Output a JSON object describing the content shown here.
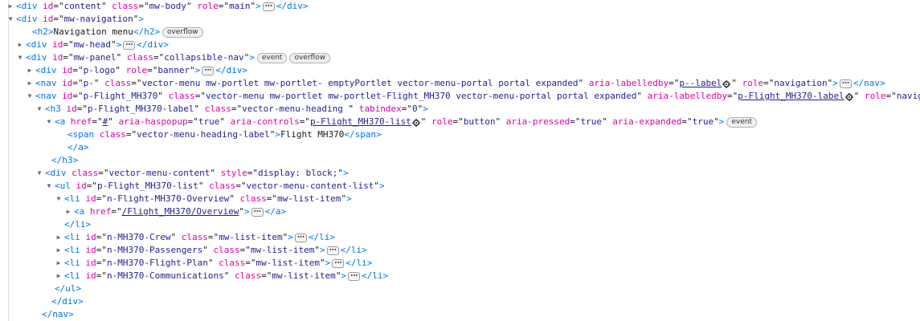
{
  "lines": [
    {
      "parts": [
        [
          "tag",
          "<"
        ],
        [
          "tname",
          "div"
        ],
        [
          "sp",
          " "
        ],
        [
          "attr",
          "id"
        ],
        [
          "eq",
          "=\""
        ],
        [
          "val",
          "content"
        ],
        [
          "eq",
          "\" "
        ],
        [
          "attr",
          "class"
        ],
        [
          "eq",
          "=\""
        ],
        [
          "val",
          "mw-body"
        ],
        [
          "eq",
          "\" "
        ],
        [
          "attr",
          "role"
        ],
        [
          "eq",
          "=\""
        ],
        [
          "val",
          "main"
        ],
        [
          "eq",
          "\""
        ],
        [
          "tag",
          ">"
        ],
        [
          "ell",
          ""
        ],
        [
          "tag",
          "</"
        ],
        [
          "tname",
          "div"
        ],
        [
          "tag",
          ">"
        ]
      ]
    },
    {
      "parts": [
        [
          "tag",
          "<"
        ],
        [
          "tname",
          "div"
        ],
        [
          "sp",
          " "
        ],
        [
          "attr",
          "id"
        ],
        [
          "eq",
          "=\""
        ],
        [
          "val",
          "mw-navigation"
        ],
        [
          "eq",
          "\""
        ],
        [
          "tag",
          ">"
        ]
      ]
    },
    {
      "parts": [
        [
          "tag",
          "<"
        ],
        [
          "tname",
          "h2"
        ],
        [
          "tag",
          ">"
        ],
        [
          "text",
          "Navigation menu"
        ],
        [
          "tag",
          "</"
        ],
        [
          "tname",
          "h2"
        ],
        [
          "tag",
          ">"
        ],
        [
          "badge",
          "overflow"
        ]
      ]
    },
    {
      "parts": [
        [
          "tag",
          "<"
        ],
        [
          "tname",
          "div"
        ],
        [
          "sp",
          " "
        ],
        [
          "attr",
          "id"
        ],
        [
          "eq",
          "=\""
        ],
        [
          "val",
          "mw-head"
        ],
        [
          "eq",
          "\""
        ],
        [
          "tag",
          ">"
        ],
        [
          "ell",
          ""
        ],
        [
          "tag",
          "</"
        ],
        [
          "tname",
          "div"
        ],
        [
          "tag",
          ">"
        ]
      ]
    },
    {
      "parts": [
        [
          "tag",
          "<"
        ],
        [
          "tname",
          "div"
        ],
        [
          "sp",
          " "
        ],
        [
          "attr",
          "id"
        ],
        [
          "eq",
          "=\""
        ],
        [
          "val",
          "mw-panel"
        ],
        [
          "eq",
          "\" "
        ],
        [
          "attr",
          "class"
        ],
        [
          "eq",
          "=\""
        ],
        [
          "val",
          "collapsible-nav"
        ],
        [
          "eq",
          "\""
        ],
        [
          "tag",
          ">"
        ],
        [
          "badge",
          "event"
        ],
        [
          "badge",
          "overflow"
        ]
      ]
    },
    {
      "parts": [
        [
          "tag",
          "<"
        ],
        [
          "tname",
          "div"
        ],
        [
          "sp",
          " "
        ],
        [
          "attr",
          "id"
        ],
        [
          "eq",
          "=\""
        ],
        [
          "val",
          "p-logo"
        ],
        [
          "eq",
          "\" "
        ],
        [
          "attr",
          "role"
        ],
        [
          "eq",
          "=\""
        ],
        [
          "val",
          "banner"
        ],
        [
          "eq",
          "\""
        ],
        [
          "tag",
          ">"
        ],
        [
          "ell",
          ""
        ],
        [
          "tag",
          "</"
        ],
        [
          "tname",
          "div"
        ],
        [
          "tag",
          ">"
        ]
      ]
    },
    {
      "parts": [
        [
          "tag",
          "<"
        ],
        [
          "tname",
          "nav"
        ],
        [
          "sp",
          " "
        ],
        [
          "attr",
          "id"
        ],
        [
          "eq",
          "=\""
        ],
        [
          "val",
          "p-"
        ],
        [
          "eq",
          "\" "
        ],
        [
          "attr",
          "class"
        ],
        [
          "eq",
          "=\""
        ],
        [
          "val",
          "vector-menu mw-portlet mw-portlet- emptyPortlet vector-menu-portal portal expanded"
        ],
        [
          "eq",
          "\" "
        ],
        [
          "attr",
          "aria-labelledby"
        ],
        [
          "eq",
          "=\""
        ],
        [
          "link",
          "p--label"
        ],
        [
          "gear",
          ""
        ],
        [
          "eq",
          "\" "
        ],
        [
          "attr",
          "role"
        ],
        [
          "eq",
          "=\""
        ],
        [
          "val",
          "navigation"
        ],
        [
          "eq",
          "\""
        ],
        [
          "tag",
          ">"
        ],
        [
          "ell",
          ""
        ],
        [
          "tag",
          "</"
        ],
        [
          "tname",
          "nav"
        ],
        [
          "tag",
          ">"
        ]
      ]
    },
    {
      "parts": [
        [
          "tag",
          "<"
        ],
        [
          "tname",
          "nav"
        ],
        [
          "sp",
          " "
        ],
        [
          "attr",
          "id"
        ],
        [
          "eq",
          "=\""
        ],
        [
          "val",
          "p-Flight_MH370"
        ],
        [
          "eq",
          "\" "
        ],
        [
          "attr",
          "class"
        ],
        [
          "eq",
          "=\""
        ],
        [
          "val",
          "vector-menu mw-portlet mw-portlet-Flight_MH370 vector-menu-portal portal expanded"
        ],
        [
          "eq",
          "\" "
        ],
        [
          "attr",
          "aria-labelledby"
        ],
        [
          "eq",
          "=\""
        ],
        [
          "link",
          "p-Flight_MH370-label"
        ],
        [
          "gear",
          ""
        ],
        [
          "eq",
          "\" "
        ],
        [
          "attr",
          "role"
        ],
        [
          "eq",
          "=\""
        ],
        [
          "val",
          "navigation"
        ],
        [
          "eq",
          "\""
        ],
        [
          "tag",
          ">"
        ]
      ]
    },
    {
      "parts": [
        [
          "tag",
          "<"
        ],
        [
          "tname",
          "h3"
        ],
        [
          "sp",
          " "
        ],
        [
          "attr",
          "id"
        ],
        [
          "eq",
          "=\""
        ],
        [
          "val",
          "p-Flight_MH370-label"
        ],
        [
          "eq",
          "\" "
        ],
        [
          "attr",
          "class"
        ],
        [
          "eq",
          "=\""
        ],
        [
          "val",
          "vector-menu-heading "
        ],
        [
          "eq",
          "\" "
        ],
        [
          "attr",
          "tabindex"
        ],
        [
          "eq",
          "=\""
        ],
        [
          "val",
          "0"
        ],
        [
          "eq",
          "\""
        ],
        [
          "tag",
          ">"
        ]
      ]
    },
    {
      "parts": [
        [
          "tag",
          "<"
        ],
        [
          "tname",
          "a"
        ],
        [
          "sp",
          " "
        ],
        [
          "attr",
          "href"
        ],
        [
          "eq",
          "=\""
        ],
        [
          "link",
          "#"
        ],
        [
          "eq",
          "\" "
        ],
        [
          "attr",
          "aria-haspopup"
        ],
        [
          "eq",
          "=\""
        ],
        [
          "val",
          "true"
        ],
        [
          "eq",
          "\" "
        ],
        [
          "attr",
          "aria-controls"
        ],
        [
          "eq",
          "=\""
        ],
        [
          "link",
          "p-Flight_MH370-list"
        ],
        [
          "gear",
          ""
        ],
        [
          "eq",
          "\" "
        ],
        [
          "attr",
          "role"
        ],
        [
          "eq",
          "=\""
        ],
        [
          "val",
          "button"
        ],
        [
          "eq",
          "\" "
        ],
        [
          "attr",
          "aria-pressed"
        ],
        [
          "eq",
          "=\""
        ],
        [
          "val",
          "true"
        ],
        [
          "eq",
          "\" "
        ],
        [
          "attr",
          "aria-expanded"
        ],
        [
          "eq",
          "=\""
        ],
        [
          "val",
          "true"
        ],
        [
          "eq",
          "\""
        ],
        [
          "tag",
          ">"
        ],
        [
          "badge",
          "event"
        ]
      ]
    },
    {
      "parts": [
        [
          "tag",
          "<"
        ],
        [
          "tname",
          "span"
        ],
        [
          "sp",
          " "
        ],
        [
          "attr",
          "class"
        ],
        [
          "eq",
          "=\""
        ],
        [
          "val",
          "vector-menu-heading-label"
        ],
        [
          "eq",
          "\""
        ],
        [
          "tag",
          ">"
        ],
        [
          "text",
          "Flight MH370"
        ],
        [
          "tag",
          "</"
        ],
        [
          "tname",
          "span"
        ],
        [
          "tag",
          ">"
        ]
      ]
    },
    {
      "parts": [
        [
          "tag",
          "</"
        ],
        [
          "tname",
          "a"
        ],
        [
          "tag",
          ">"
        ]
      ]
    },
    {
      "parts": [
        [
          "tag",
          "</"
        ],
        [
          "tname",
          "h3"
        ],
        [
          "tag",
          ">"
        ]
      ]
    },
    {
      "parts": [
        [
          "tag",
          "<"
        ],
        [
          "tname",
          "div"
        ],
        [
          "sp",
          " "
        ],
        [
          "attr",
          "class"
        ],
        [
          "eq",
          "=\""
        ],
        [
          "val",
          "vector-menu-content"
        ],
        [
          "eq",
          "\" "
        ],
        [
          "attr",
          "style"
        ],
        [
          "eq",
          "=\""
        ],
        [
          "val",
          "display: block;"
        ],
        [
          "eq",
          "\""
        ],
        [
          "tag",
          ">"
        ]
      ]
    },
    {
      "parts": [
        [
          "tag",
          "<"
        ],
        [
          "tname",
          "ul"
        ],
        [
          "sp",
          " "
        ],
        [
          "attr",
          "id"
        ],
        [
          "eq",
          "=\""
        ],
        [
          "val",
          "p-Flight_MH370-list"
        ],
        [
          "eq",
          "\" "
        ],
        [
          "attr",
          "class"
        ],
        [
          "eq",
          "=\""
        ],
        [
          "val",
          "vector-menu-content-list"
        ],
        [
          "eq",
          "\""
        ],
        [
          "tag",
          ">"
        ]
      ]
    },
    {
      "parts": [
        [
          "tag",
          "<"
        ],
        [
          "tname",
          "li"
        ],
        [
          "sp",
          " "
        ],
        [
          "attr",
          "id"
        ],
        [
          "eq",
          "=\""
        ],
        [
          "val",
          "n-Flight-MH370-Overview"
        ],
        [
          "eq",
          "\" "
        ],
        [
          "attr",
          "class"
        ],
        [
          "eq",
          "=\""
        ],
        [
          "val",
          "mw-list-item"
        ],
        [
          "eq",
          "\""
        ],
        [
          "tag",
          ">"
        ]
      ]
    },
    {
      "parts": [
        [
          "tag",
          "<"
        ],
        [
          "tname",
          "a"
        ],
        [
          "sp",
          " "
        ],
        [
          "attr",
          "href"
        ],
        [
          "eq",
          "=\""
        ],
        [
          "link",
          "/Flight_MH370/Overview"
        ],
        [
          "eq",
          "\""
        ],
        [
          "tag",
          ">"
        ],
        [
          "ell",
          ""
        ],
        [
          "tag",
          "</"
        ],
        [
          "tname",
          "a"
        ],
        [
          "tag",
          ">"
        ]
      ]
    },
    {
      "parts": [
        [
          "tag",
          "</"
        ],
        [
          "tname",
          "li"
        ],
        [
          "tag",
          ">"
        ]
      ]
    },
    {
      "parts": [
        [
          "tag",
          "<"
        ],
        [
          "tname",
          "li"
        ],
        [
          "sp",
          " "
        ],
        [
          "attr",
          "id"
        ],
        [
          "eq",
          "=\""
        ],
        [
          "val",
          "n-MH370-Crew"
        ],
        [
          "eq",
          "\" "
        ],
        [
          "attr",
          "class"
        ],
        [
          "eq",
          "=\""
        ],
        [
          "val",
          "mw-list-item"
        ],
        [
          "eq",
          "\""
        ],
        [
          "tag",
          ">"
        ],
        [
          "ell",
          ""
        ],
        [
          "tag",
          "</"
        ],
        [
          "tname",
          "li"
        ],
        [
          "tag",
          ">"
        ]
      ]
    },
    {
      "parts": [
        [
          "tag",
          "<"
        ],
        [
          "tname",
          "li"
        ],
        [
          "sp",
          " "
        ],
        [
          "attr",
          "id"
        ],
        [
          "eq",
          "=\""
        ],
        [
          "val",
          "n-MH370-Passengers"
        ],
        [
          "eq",
          "\" "
        ],
        [
          "attr",
          "class"
        ],
        [
          "eq",
          "=\""
        ],
        [
          "val",
          "mw-list-item"
        ],
        [
          "eq",
          "\""
        ],
        [
          "tag",
          ">"
        ],
        [
          "ell",
          ""
        ],
        [
          "tag",
          "</"
        ],
        [
          "tname",
          "li"
        ],
        [
          "tag",
          ">"
        ]
      ]
    },
    {
      "parts": [
        [
          "tag",
          "<"
        ],
        [
          "tname",
          "li"
        ],
        [
          "sp",
          " "
        ],
        [
          "attr",
          "id"
        ],
        [
          "eq",
          "=\""
        ],
        [
          "val",
          "n-MH370-Flight-Plan"
        ],
        [
          "eq",
          "\" "
        ],
        [
          "attr",
          "class"
        ],
        [
          "eq",
          "=\""
        ],
        [
          "val",
          "mw-list-item"
        ],
        [
          "eq",
          "\""
        ],
        [
          "tag",
          ">"
        ],
        [
          "ell",
          ""
        ],
        [
          "tag",
          "</"
        ],
        [
          "tname",
          "li"
        ],
        [
          "tag",
          ">"
        ]
      ]
    },
    {
      "parts": [
        [
          "tag",
          "<"
        ],
        [
          "tname",
          "li"
        ],
        [
          "sp",
          " "
        ],
        [
          "attr",
          "id"
        ],
        [
          "eq",
          "=\""
        ],
        [
          "val",
          "n-MH370-Communications"
        ],
        [
          "eq",
          "\" "
        ],
        [
          "attr",
          "class"
        ],
        [
          "eq",
          "=\""
        ],
        [
          "val",
          "mw-list-item"
        ],
        [
          "eq",
          "\""
        ],
        [
          "tag",
          ">"
        ],
        [
          "ell",
          ""
        ],
        [
          "tag",
          "</"
        ],
        [
          "tname",
          "li"
        ],
        [
          "tag",
          ">"
        ]
      ]
    },
    {
      "parts": [
        [
          "tag",
          "</"
        ],
        [
          "tname",
          "ul"
        ],
        [
          "tag",
          ">"
        ]
      ]
    },
    {
      "parts": [
        [
          "tag",
          "</"
        ],
        [
          "tname",
          "div"
        ],
        [
          "tag",
          ">"
        ]
      ]
    },
    {
      "parts": [
        [
          "tag",
          "</"
        ],
        [
          "tname",
          "nav"
        ],
        [
          "tag",
          ">"
        ]
      ]
    }
  ],
  "twisties": [
    "collapsed",
    "expanded",
    "none",
    "collapsed",
    "expanded",
    "collapsed",
    "collapsed",
    "expanded",
    "expanded",
    "expanded",
    "none",
    "none",
    "none",
    "expanded",
    "expanded",
    "expanded",
    "collapsed",
    "none",
    "collapsed",
    "collapsed",
    "collapsed",
    "collapsed",
    "none",
    "none",
    "none"
  ],
  "colors": {
    "tag": "#0074e8",
    "attribute": "#dd00a9",
    "value": "#1f1f8f",
    "text": "#1a1a1a"
  }
}
